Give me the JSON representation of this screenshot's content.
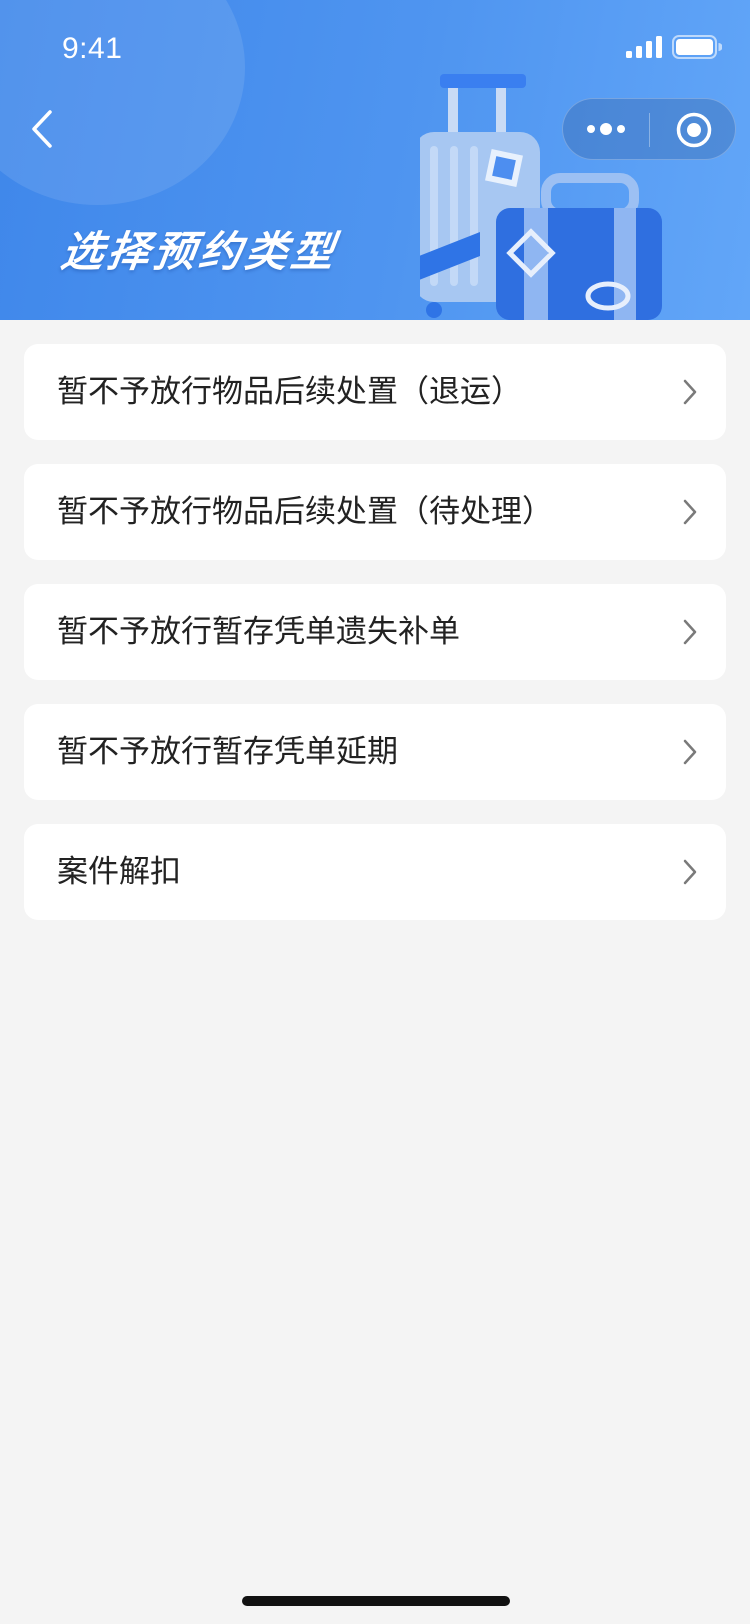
{
  "status_bar": {
    "time": "9:41"
  },
  "header": {
    "title": "选择预约类型",
    "colors": {
      "gradient_start": "#3f87ea",
      "gradient_end": "#62a6f8"
    }
  },
  "nav": {
    "back_icon": "chevron-left-icon",
    "capsule_icons": [
      "more-icon",
      "target-icon"
    ]
  },
  "options": [
    {
      "label": "暂不予放行物品后续处置（退运）"
    },
    {
      "label": "暂不予放行物品后续处置（待处理）"
    },
    {
      "label": "暂不予放行暂存凭单遗失补单"
    },
    {
      "label": "暂不予放行暂存凭单延期"
    },
    {
      "label": "案件解扣"
    }
  ]
}
